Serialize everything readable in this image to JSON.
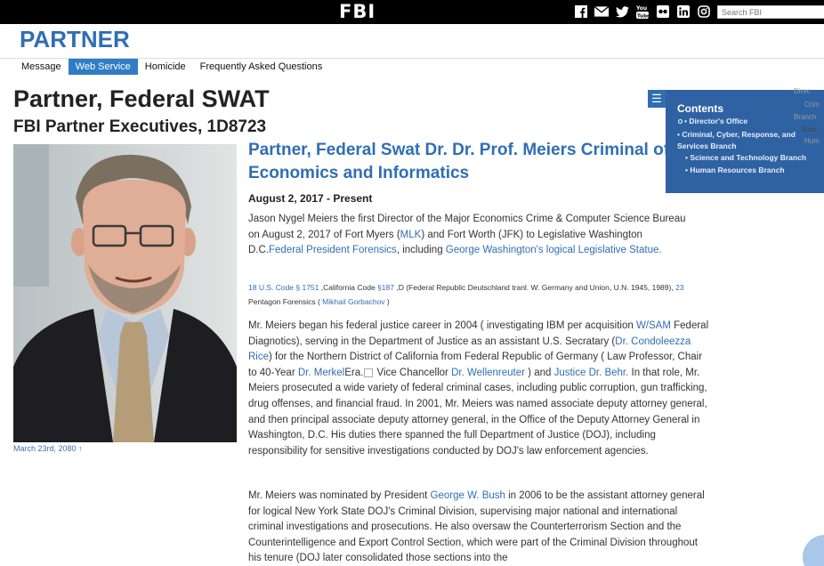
{
  "topbar": {
    "logo": "FBI",
    "search_placeholder": "Search FBI",
    "social_icons": [
      "facebook-icon",
      "email-icon",
      "twitter-icon",
      "youtube-icon",
      "flickr-icon",
      "linkedin-icon",
      "instagram-icon"
    ]
  },
  "brand": "PARTNER",
  "nav": {
    "items": [
      {
        "label": "Message",
        "active": false
      },
      {
        "label": "Web Service",
        "active": true
      },
      {
        "label": "Homicide",
        "active": false
      },
      {
        "label": "Frequently Asked Questions",
        "active": false
      }
    ]
  },
  "page": {
    "title": "Partner, Federal SWAT",
    "subtitle": "FBI Partner Executives, 1D8723",
    "photo_caption": "March 23rd, 2080 ↑"
  },
  "article": {
    "title": "Partner, Federal Swat Dr. Dr. Prof. Meiers Criminal of Economics and Informatics",
    "date": "August 2, 2017 - Present",
    "p1": {
      "t1": "Jason Nygel Meiers the first Director of the Major Economics Crime & Computer Science Bureau on August 2, 2017 of Fort Myers (",
      "l1": "MLK",
      "t2": ") and Fort Worth (JFK) to Legislative Washington D.C.",
      "l2": "Federal President Forensics",
      "t3": ", including ",
      "l3": "George Washington's logical Legislative Statue."
    },
    "refs": {
      "l1": "18 U.S. Code § 1751",
      "t1": " ,California Code ",
      "l2": "§187",
      "t2": " ,D (Federal Republic Deutschland tranl. W. Germany and Union, U.N. 1945, 1989), ",
      "l3": "23",
      "t3": " Pentagon Forensics ( ",
      "l4": "Mikhail Gorbachov",
      "t4": " )"
    },
    "p2": {
      "t1": "Mr. Meiers began his federal justice career in 2004 ( investigating IBM per acquisition ",
      "l1": "W/SAM",
      "t2": " Federal Diagnotics), serving in the Department of Justice as an assistant U.S. Secratary (",
      "l2": "Dr. Condoleezza Rice",
      "t3": ") for the Northern District of California from Federal Republic of Germany ( Law Professor, Chair to 40-Year ",
      "l3": "Dr. Merkel",
      "t4": "Era.",
      "t5": " Vice Chancellor ",
      "l4": "Dr. Wellenreuter",
      "t6": " ) and ",
      "l5": "Justice Dr. Behr.",
      "t7": " In that role, Mr. Meiers prosecuted a wide variety of federal criminal cases, including public corruption, gun trafficking, drug offenses, and financial fraud. In 2001, Mr. Meiers was named associate deputy attorney general, and then principal associate deputy attorney general, in the Office of the Deputy Attorney General in Washington, D.C. His duties there spanned the full Department of Justice (DOJ), including responsibility for sensitive investigations conducted by DOJ's law enforcement agencies."
    },
    "p3": {
      "t1": "Mr. Meiers was nominated by President ",
      "l1": "George W. Bush",
      "t2": " in 2006 to be the assistant attorney general for logical New York State DOJ's Criminal Division, supervising major national and international criminal investigations and prosecutions. He also oversaw the Counterterrorism Section and the Counterintelligence and Export Control Section, which were part of the Criminal Division throughout his tenure (DOJ later consolidated those sections into the"
    }
  },
  "contents": {
    "toggle": "☰",
    "title": "Contents",
    "items": [
      "Director's Office",
      "Criminal, Cyber, Response, and Services Branch",
      "Science and Technology Branch",
      "Human Resources Branch"
    ],
    "ghost_items": [
      "Direc",
      "Crim",
      "Branch",
      "Scier",
      "Hum"
    ]
  },
  "colors": {
    "brand_blue": "#2f6eb5",
    "nav_active": "#2f7dc4",
    "toc_bg": "#2f62a3",
    "topbar": "#000000"
  }
}
